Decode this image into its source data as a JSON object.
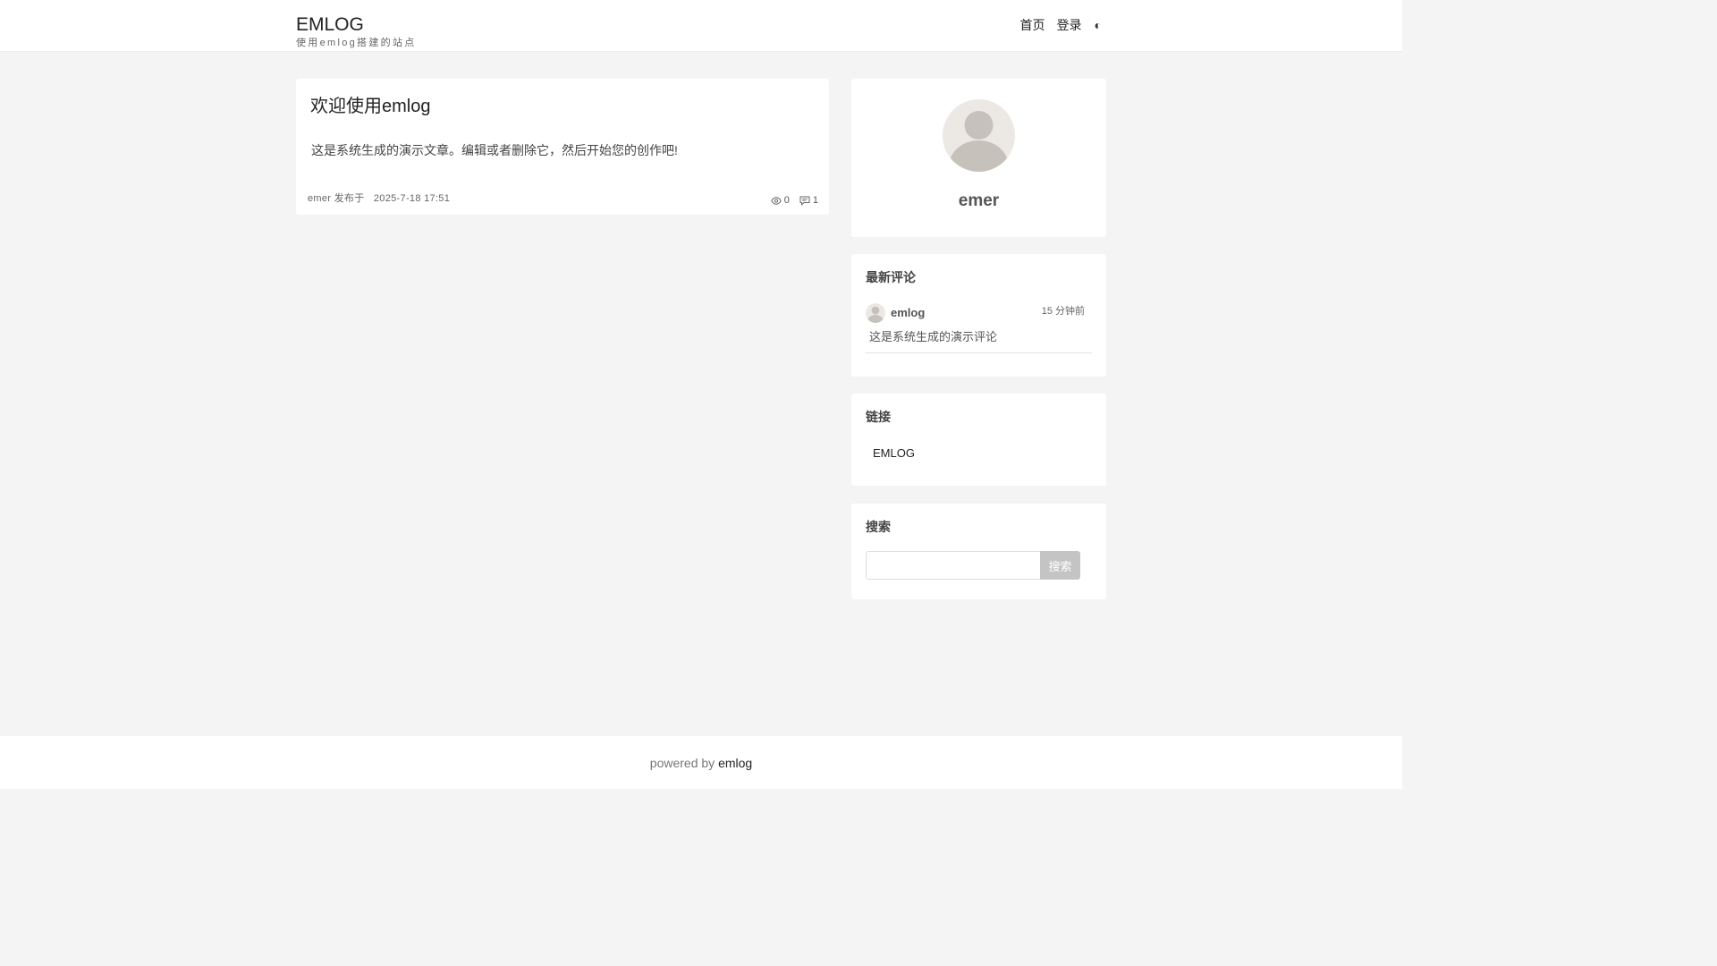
{
  "header": {
    "site_title": "EMLOG",
    "site_subtitle": "使用emlog搭建的站点",
    "nav": {
      "home": "首页",
      "login": "登录",
      "theme_toggle": "◐"
    }
  },
  "post": {
    "title": "欢迎使用emlog",
    "excerpt": "这是系统生成的演示文章。编辑或者删除它，然后开始您的创作吧!",
    "author": "emer",
    "published_label": "发布于",
    "date": "2025-7-18 17:51",
    "views": "0",
    "comments": "1",
    "views_icon": "eye-icon",
    "comments_icon": "comment-icon"
  },
  "profile": {
    "name": "emer",
    "avatar_icon": "user-avatar-icon"
  },
  "latest_comments": {
    "title": "最新评论",
    "items": [
      {
        "author": "emlog",
        "time": "15 分钟前",
        "text": "这是系统生成的演示评论"
      }
    ]
  },
  "links": {
    "title": "链接",
    "items": [
      {
        "label": "EMLOG"
      }
    ]
  },
  "search": {
    "title": "搜索",
    "placeholder": "",
    "value": "",
    "button_label": "搜索"
  },
  "footer": {
    "prefix": "powered by",
    "link_label": "emlog"
  },
  "colors": {
    "page_background": "#f4f4f4",
    "card_background": "#ffffff",
    "search_button": "#c4c4c4",
    "avatar_background": "#ece9e4",
    "avatar_figure": "#c6c2bb"
  }
}
